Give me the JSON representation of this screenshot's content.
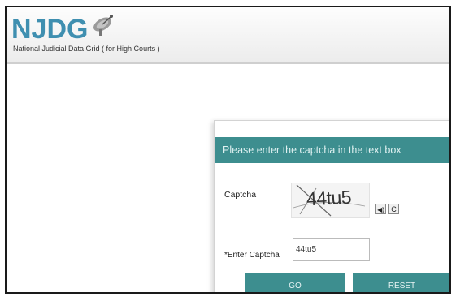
{
  "header": {
    "logo_text": "NJDG",
    "tagline": "National Judicial Data Grid ( for High Courts )"
  },
  "modal": {
    "title": "Please enter the captcha in the text box",
    "captcha_label": "Captcha",
    "captcha_image_text": "44tu5",
    "audio_icon": "speaker-icon",
    "refresh_icon": "refresh-icon",
    "refresh_glyph": "C",
    "enter_label": "*Enter Captcha",
    "enter_value": "44tu5",
    "go_label": "GO",
    "reset_label": "RESET"
  },
  "colors": {
    "accent": "#3d8e8f",
    "logo": "#3f8fb0"
  }
}
